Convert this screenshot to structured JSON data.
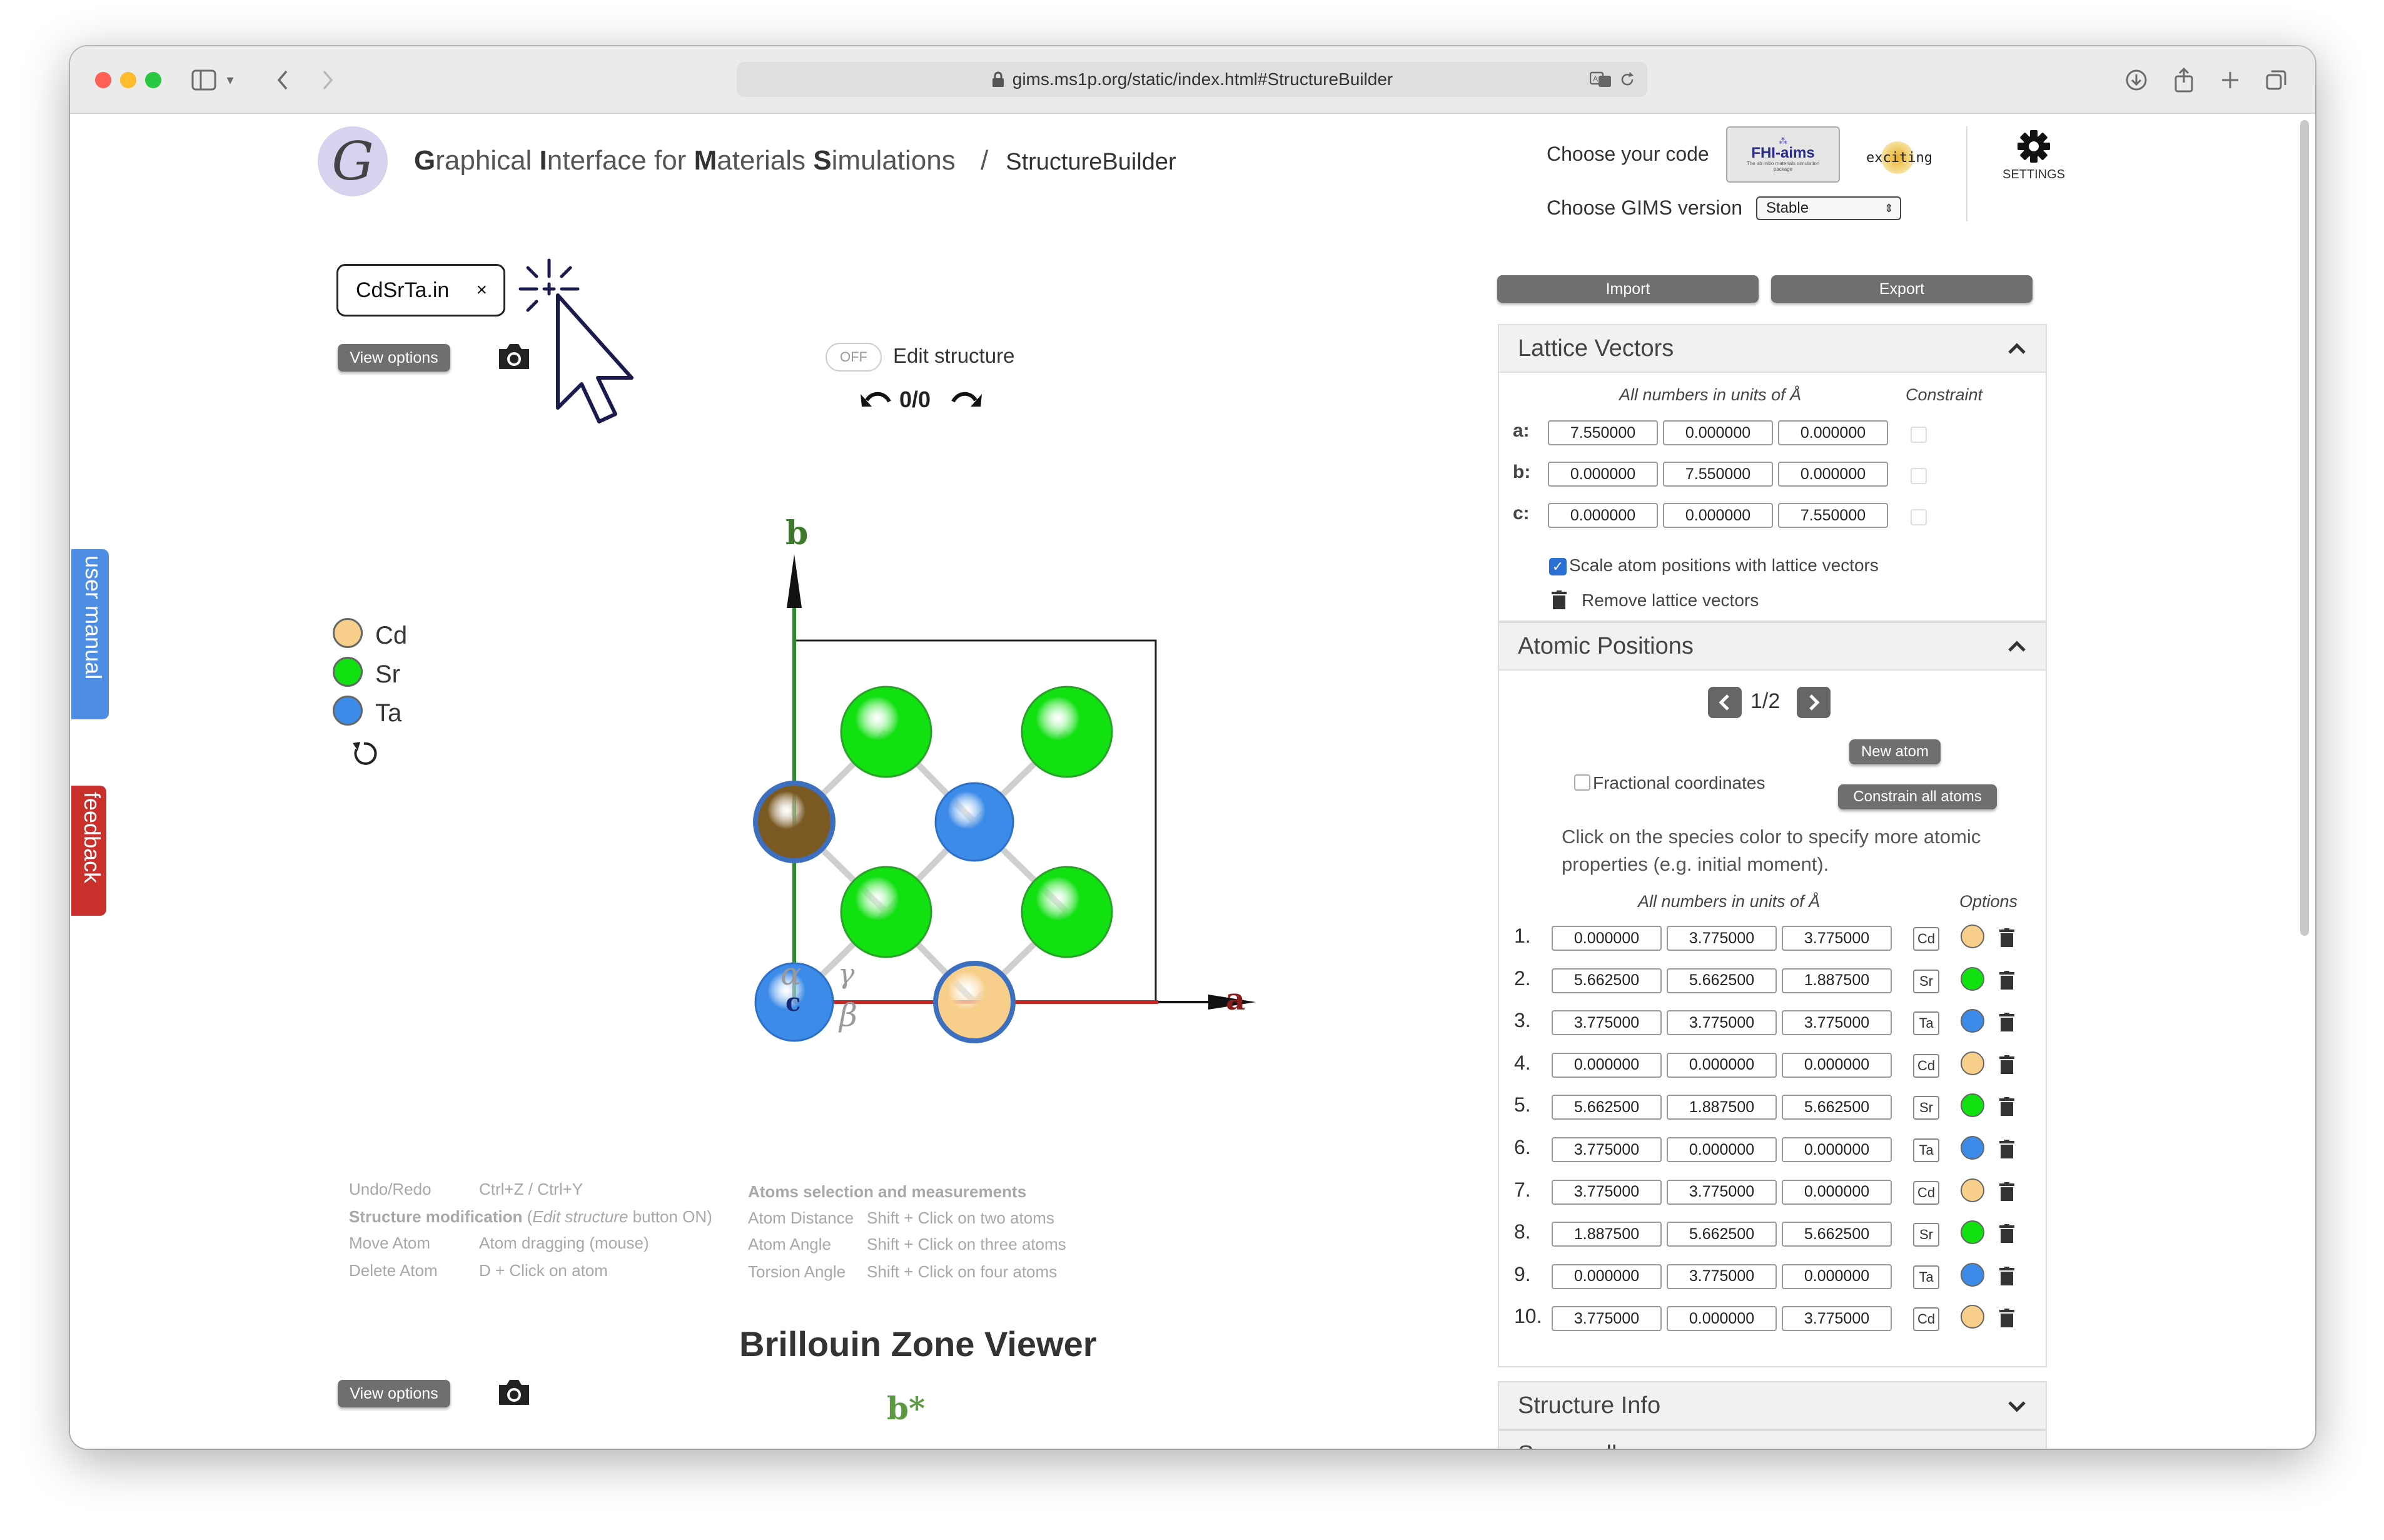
{
  "browser": {
    "url": "gims.ms1p.org/static/index.html#StructureBuilder",
    "traffic_colors": [
      "#ff5f57",
      "#febc2e",
      "#28c840"
    ]
  },
  "header": {
    "logo_letter": "G",
    "title_parts": [
      {
        "initial": "G",
        "rest": "raphical "
      },
      {
        "initial": "I",
        "rest": "nterface for "
      },
      {
        "initial": "M",
        "rest": "aterials "
      },
      {
        "initial": "S",
        "rest": "imulations"
      }
    ],
    "separator": "/",
    "page": "StructureBuilder",
    "choose_code_label": "Choose your code",
    "code_options": [
      "FHI-aims",
      "exciting"
    ],
    "fhi_tagline": "The ab initio materials simulation package",
    "version_label": "Choose GIMS version",
    "version_value": "Stable",
    "settings_label": "SETTINGS"
  },
  "side_tabs": {
    "manual": "user manual",
    "feedback": "feedback"
  },
  "viewer": {
    "file_tab": "CdSrTa.in",
    "close": "×",
    "view_options": "View options",
    "toggle": "OFF",
    "edit_label": "Edit structure",
    "undo_counter": "0/0",
    "legend": [
      {
        "name": "Cd",
        "color": "#f7cf8a"
      },
      {
        "name": "Sr",
        "color": "#11e011"
      },
      {
        "name": "Ta",
        "color": "#3d8be8"
      }
    ],
    "axes": {
      "a": "a",
      "b": "b",
      "c": "c",
      "alpha": "α",
      "beta": "β",
      "gamma": "γ"
    },
    "atom_colors": {
      "Cd": "#f7cf8a",
      "Sr": "#11e011",
      "Ta": "#3d8be8",
      "Cd_dark": "#7a5a22"
    }
  },
  "help": {
    "left": [
      {
        "k": "Undo/Redo",
        "v": "Ctrl+Z / Ctrl+Y"
      },
      {
        "k": "Structure modification",
        "note_pre": " (",
        "note": "Edit structure",
        "note_post": " button ON)"
      },
      {
        "k": "Move Atom",
        "v": "Atom dragging (mouse)"
      },
      {
        "k": "Delete Atom",
        "v": "D + Click on atom"
      }
    ],
    "right_title": "Atoms selection and measurements",
    "right": [
      {
        "k": "Atom Distance",
        "v": "Shift + Click on two atoms"
      },
      {
        "k": "Atom Angle",
        "v": "Shift + Click on three atoms"
      },
      {
        "k": "Torsion Angle",
        "v": "Shift + Click on four atoms"
      }
    ]
  },
  "bz": {
    "title": "Brillouin Zone Viewer",
    "view_options": "View options",
    "axis_label": "b*"
  },
  "panel": {
    "import": "Import",
    "export": "Export",
    "lattice": {
      "title": "Lattice Vectors",
      "units": "All numbers in units of Å",
      "constraint": "Constraint",
      "rows": [
        {
          "label": "a:",
          "values": [
            "7.550000",
            "0.000000",
            "0.000000"
          ]
        },
        {
          "label": "b:",
          "values": [
            "0.000000",
            "7.550000",
            "0.000000"
          ]
        },
        {
          "label": "c:",
          "values": [
            "0.000000",
            "0.000000",
            "7.550000"
          ]
        }
      ],
      "scale": "Scale atom positions with lattice vectors",
      "remove": "Remove lattice vectors"
    },
    "atoms": {
      "title": "Atomic Positions",
      "page": "1/2",
      "new_atom": "New atom",
      "fractional": "Fractional coordinates",
      "constrain_all": "Constrain all atoms",
      "hint": "Click on the species color to specify more atomic properties (e.g. initial moment).",
      "units": "All numbers in units of Å",
      "options": "Options",
      "rows": [
        {
          "n": "1.",
          "v": [
            "0.000000",
            "3.775000",
            "3.775000"
          ],
          "sp": "Cd",
          "c": "#f7cf8a"
        },
        {
          "n": "2.",
          "v": [
            "5.662500",
            "5.662500",
            "1.887500"
          ],
          "sp": "Sr",
          "c": "#11e011"
        },
        {
          "n": "3.",
          "v": [
            "3.775000",
            "3.775000",
            "3.775000"
          ],
          "sp": "Ta",
          "c": "#3d8be8"
        },
        {
          "n": "4.",
          "v": [
            "0.000000",
            "0.000000",
            "0.000000"
          ],
          "sp": "Cd",
          "c": "#f7cf8a"
        },
        {
          "n": "5.",
          "v": [
            "5.662500",
            "1.887500",
            "5.662500"
          ],
          "sp": "Sr",
          "c": "#11e011"
        },
        {
          "n": "6.",
          "v": [
            "3.775000",
            "0.000000",
            "0.000000"
          ],
          "sp": "Ta",
          "c": "#3d8be8"
        },
        {
          "n": "7.",
          "v": [
            "3.775000",
            "3.775000",
            "0.000000"
          ],
          "sp": "Cd",
          "c": "#f7cf8a"
        },
        {
          "n": "8.",
          "v": [
            "1.887500",
            "5.662500",
            "5.662500"
          ],
          "sp": "Sr",
          "c": "#11e011"
        },
        {
          "n": "9.",
          "v": [
            "0.000000",
            "3.775000",
            "0.000000"
          ],
          "sp": "Ta",
          "c": "#3d8be8"
        },
        {
          "n": "10.",
          "v": [
            "3.775000",
            "0.000000",
            "3.775000"
          ],
          "sp": "Cd",
          "c": "#f7cf8a"
        }
      ]
    },
    "structure_info": "Structure Info",
    "supercell": "Supercell"
  }
}
